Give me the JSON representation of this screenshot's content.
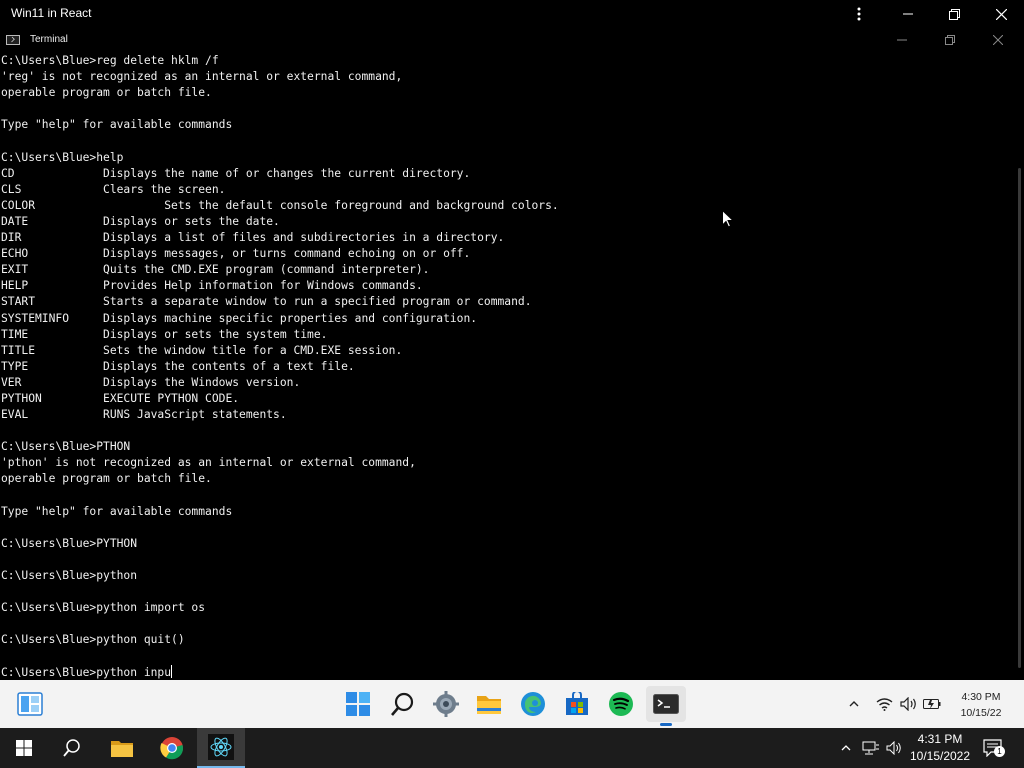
{
  "app": {
    "title": "Win11 in React",
    "menu_icon": "kebab-menu-icon",
    "minimize_icon": "minimize-icon",
    "restore_icon": "restore-icon",
    "close_icon": "close-icon"
  },
  "terminal": {
    "title": "Terminal",
    "lines": [
      "C:\\Users\\Blue>reg delete hklm /f",
      "'reg' is not recognized as an internal or external command,",
      "operable program or batch file.",
      "",
      "Type \"help\" for available commands",
      "",
      "C:\\Users\\Blue>help",
      "CD             Displays the name of or changes the current directory.",
      "CLS            Clears the screen.",
      "COLOR                   Sets the default console foreground and background colors.",
      "DATE           Displays or sets the date.",
      "DIR            Displays a list of files and subdirectories in a directory.",
      "ECHO           Displays messages, or turns command echoing on or off.",
      "EXIT           Quits the CMD.EXE program (command interpreter).",
      "HELP           Provides Help information for Windows commands.",
      "START          Starts a separate window to run a specified program or command.",
      "SYSTEMINFO     Displays machine specific properties and configuration.",
      "TIME           Displays or sets the system time.",
      "TITLE          Sets the window title for a CMD.EXE session.",
      "TYPE           Displays the contents of a text file.",
      "VER            Displays the Windows version.",
      "PYTHON         EXECUTE PYTHON CODE.",
      "EVAL           RUNS JavaScript statements.",
      "",
      "C:\\Users\\Blue>PTHON",
      "'pthon' is not recognized as an internal or external command,",
      "operable program or batch file.",
      "",
      "Type \"help\" for available commands",
      "",
      "C:\\Users\\Blue>PYTHON",
      "",
      "C:\\Users\\Blue>python",
      "",
      "C:\\Users\\Blue>python import os",
      "",
      "C:\\Users\\Blue>python quit()",
      ""
    ],
    "input_line": "C:\\Users\\Blue>python inpu"
  },
  "win11_taskbar": {
    "widgets_icon": "widgets-icon",
    "pinned": [
      "start-icon",
      "search-icon",
      "settings-icon",
      "file-explorer-icon",
      "edge-icon",
      "store-icon",
      "spotify-icon",
      "terminal-icon"
    ],
    "active": "terminal-icon",
    "tray": [
      "chevron-up-icon",
      "wifi-icon",
      "volume-icon",
      "battery-icon"
    ],
    "time": "4:30 PM",
    "date": "10/15/22"
  },
  "host_taskbar": {
    "icons": [
      "windows-start-icon",
      "search-icon",
      "file-explorer-icon",
      "chrome-icon",
      "react-app-icon"
    ],
    "tray": [
      "chevron-up-icon",
      "network-icon",
      "volume-icon"
    ],
    "time": "4:31 PM",
    "date": "10/15/2022",
    "notification_count": "1"
  },
  "colors": {
    "console_bg": "#000000",
    "console_fg": "#f0f0f0",
    "win11_taskbar_bg": "#f3f3f3",
    "host_taskbar_bg": "#1c1c1c",
    "accent": "#76b9ed"
  }
}
